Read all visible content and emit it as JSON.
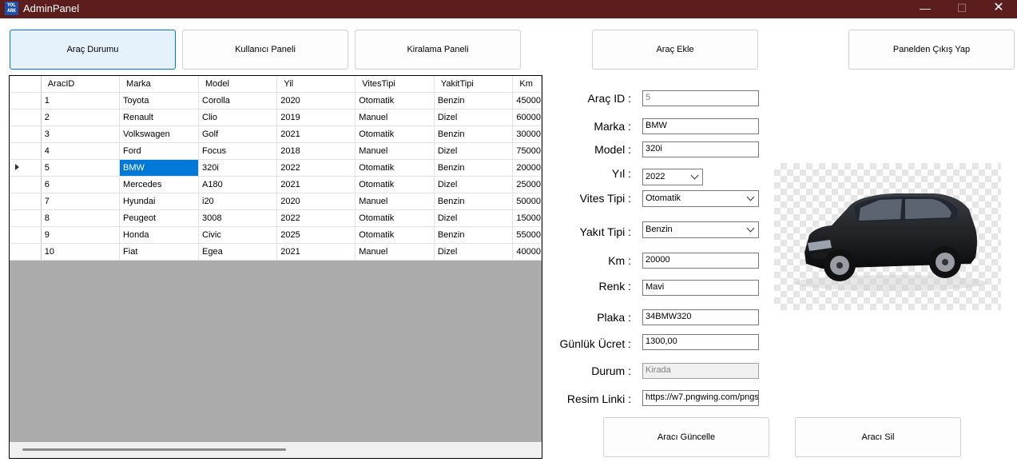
{
  "window": {
    "title": "AdminPanel",
    "icon_text": "YOL ARK",
    "controls": {
      "minimize": "—",
      "maximize": "☐",
      "close": "✕"
    }
  },
  "nav": {
    "arac_durumu": "Araç Durumu",
    "kullanici_paneli": "Kullanıcı Paneli",
    "kiralama_paneli": "Kiralama Paneli",
    "arac_ekle": "Araç Ekle",
    "cikis": "Panelden Çıkış Yap"
  },
  "grid": {
    "columns": [
      "AracID",
      "Marka",
      "Model",
      "Yil",
      "VitesTipi",
      "YakitTipi",
      "Km"
    ],
    "rows": [
      [
        "1",
        "Toyota",
        "Corolla",
        "2020",
        "Otomatik",
        "Benzin",
        "45000"
      ],
      [
        "2",
        "Renault",
        "Clio",
        "2019",
        "Manuel",
        "Dizel",
        "60000"
      ],
      [
        "3",
        "Volkswagen",
        "Golf",
        "2021",
        "Otomatik",
        "Benzin",
        "30000"
      ],
      [
        "4",
        "Ford",
        "Focus",
        "2018",
        "Manuel",
        "Dizel",
        "75000"
      ],
      [
        "5",
        "BMW",
        "320i",
        "2022",
        "Otomatik",
        "Benzin",
        "20000"
      ],
      [
        "6",
        "Mercedes",
        "A180",
        "2021",
        "Otomatik",
        "Dizel",
        "25000"
      ],
      [
        "7",
        "Hyundai",
        "i20",
        "2020",
        "Manuel",
        "Benzin",
        "50000"
      ],
      [
        "8",
        "Peugeot",
        "3008",
        "2022",
        "Otomatik",
        "Dizel",
        "15000"
      ],
      [
        "9",
        "Honda",
        "Civic",
        "2025",
        "Otomatik",
        "Benzin",
        "55000"
      ],
      [
        "10",
        "Fiat",
        "Egea",
        "2021",
        "Manuel",
        "Dizel",
        "40000"
      ]
    ],
    "selected_row": 4
  },
  "form": {
    "arac_id": {
      "label": "Araç ID :",
      "value": "5"
    },
    "marka": {
      "label": "Marka :",
      "value": "BMW"
    },
    "model": {
      "label": "Model :",
      "value": "320i"
    },
    "yil": {
      "label": "Yıl :",
      "value": "2022"
    },
    "vites": {
      "label": "Vites Tipi :",
      "value": "Otomatik"
    },
    "yakit": {
      "label": "Yakıt Tipi :",
      "value": "Benzin"
    },
    "km": {
      "label": "Km :",
      "value": "20000"
    },
    "renk": {
      "label": "Renk :",
      "value": "Mavi"
    },
    "plaka": {
      "label": "Plaka :",
      "value": "34BMW320"
    },
    "ucret": {
      "label": "Günlük Ücret :",
      "value": "1300,00"
    },
    "durum": {
      "label": "Durum :",
      "value": "Kirada"
    },
    "resim": {
      "label": "Resim Linki :",
      "value": "https://w7.pngwing.com/pngs"
    }
  },
  "actions": {
    "guncelle": "Aracı Güncelle",
    "sil": "Aracı Sil"
  },
  "colors": {
    "titlebar": "#5c1d1d",
    "selection": "#0078d7",
    "active_button": "#e5f1fb"
  },
  "image": {
    "icon": "car-photo"
  }
}
